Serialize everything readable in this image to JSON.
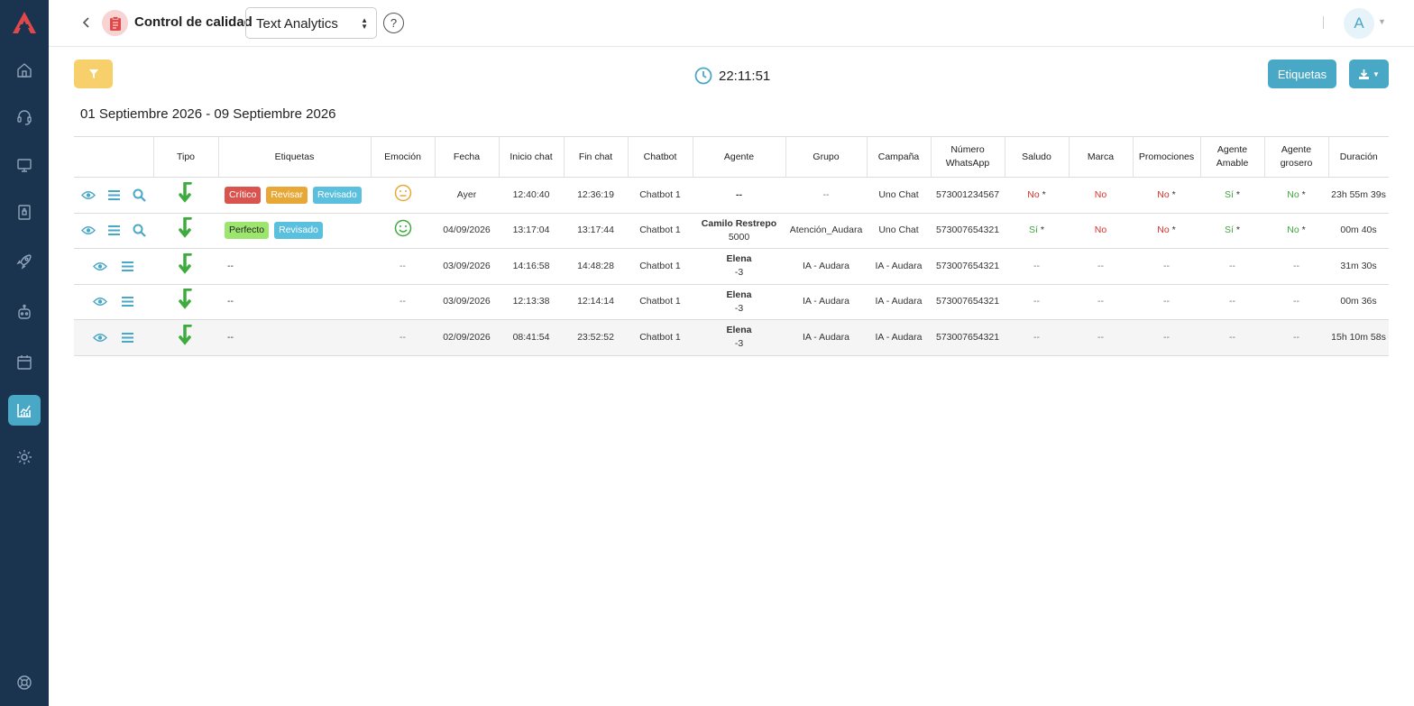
{
  "header": {
    "module_title": "Control de calidad",
    "select_value": "Text Analytics",
    "help_label": "?",
    "avatar_letter": "A"
  },
  "toolbar": {
    "clock_time": "22:11:51",
    "tags_label": "Etiquetas"
  },
  "date_range": "01 Septiembre 2026 - 09 Septiembre 2026",
  "table": {
    "columns": [
      "",
      "Tipo",
      "Etiquetas",
      "Emoción",
      "Fecha",
      "Inicio chat",
      "Fin chat",
      "Chatbot",
      "Agente",
      "Grupo",
      "Campaña",
      "Número WhatsApp",
      "Saludo",
      "Marca",
      "Promociones",
      "Agente Amable",
      "Agente grosero",
      "Duración"
    ],
    "rows": [
      {
        "tags": [
          "Crítico",
          "Revisar",
          "Revisado"
        ],
        "emotion": "neutral",
        "fecha": "Ayer",
        "inicio": "12:40:40",
        "fin": "12:36:19",
        "chatbot": "Chatbot 1",
        "agente_name": "--",
        "agente_ext": "",
        "grupo": "--",
        "campana": "Uno Chat",
        "numero": "573001234567",
        "saludo": "No",
        "saludo_ast": "*",
        "marca": "No",
        "marca_ast": "",
        "promociones": "No",
        "promociones_ast": "*",
        "amable": "Sí",
        "amable_ast": "*",
        "grosero": "No",
        "grosero_ast": "*",
        "duracion": "23h 55m 39s"
      },
      {
        "tags": [
          "Perfecto",
          "Revisado"
        ],
        "emotion": "happy",
        "fecha": "04/09/2026",
        "inicio": "13:17:04",
        "fin": "13:17:44",
        "chatbot": "Chatbot 1",
        "agente_name": "Camilo Restrepo",
        "agente_ext": "5000",
        "grupo": "Atención_Audara",
        "campana": "Uno Chat",
        "numero": "573007654321",
        "saludo": "Sí",
        "saludo_ast": "*",
        "marca": "No",
        "marca_ast": "",
        "promociones": "No",
        "promociones_ast": "*",
        "amable": "Sí",
        "amable_ast": "*",
        "grosero": "No",
        "grosero_ast": "*",
        "duracion": "00m 40s"
      },
      {
        "tags_text": "--",
        "emotion_text": "--",
        "fecha": "03/09/2026",
        "inicio": "14:16:58",
        "fin": "14:48:28",
        "chatbot": "Chatbot 1",
        "agente_name": "Elena",
        "agente_ext": "-3",
        "grupo": "IA - Audara",
        "campana": "IA - Audara",
        "numero": "573007654321",
        "saludo": "--",
        "marca": "--",
        "promociones": "--",
        "amable": "--",
        "grosero": "--",
        "duracion": "31m 30s"
      },
      {
        "tags_text": "--",
        "emotion_text": "--",
        "fecha": "03/09/2026",
        "inicio": "12:13:38",
        "fin": "12:14:14",
        "chatbot": "Chatbot 1",
        "agente_name": "Elena",
        "agente_ext": "-3",
        "grupo": "IA - Audara",
        "campana": "IA - Audara",
        "numero": "573007654321",
        "saludo": "--",
        "marca": "--",
        "promociones": "--",
        "amable": "--",
        "grosero": "--",
        "duracion": "00m 36s"
      },
      {
        "tags_text": "--",
        "emotion_text": "--",
        "fecha": "02/09/2026",
        "inicio": "08:41:54",
        "fin": "23:52:52",
        "chatbot": "Chatbot 1",
        "agente_name": "Elena",
        "agente_ext": "-3",
        "grupo": "IA - Audara",
        "campana": "IA - Audara",
        "numero": "573007654321",
        "saludo": "--",
        "marca": "--",
        "promociones": "--",
        "amable": "--",
        "grosero": "--",
        "duracion": "15h 10m 58s"
      }
    ]
  }
}
